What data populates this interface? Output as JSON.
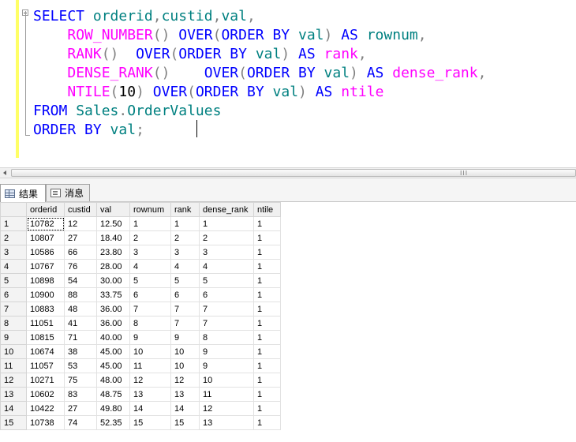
{
  "editor": {
    "lines": [
      [
        {
          "t": "SELECT ",
          "c": "kw"
        },
        {
          "t": "orderid",
          "c": "id"
        },
        {
          "t": ",",
          "c": "op"
        },
        {
          "t": "custid",
          "c": "id"
        },
        {
          "t": ",",
          "c": "op"
        },
        {
          "t": "val",
          "c": "id"
        },
        {
          "t": ",",
          "c": "op"
        }
      ],
      [
        {
          "t": "    ",
          "c": "tx"
        },
        {
          "t": "ROW_NUMBER",
          "c": "fn"
        },
        {
          "t": "() ",
          "c": "op"
        },
        {
          "t": "OVER",
          "c": "kw"
        },
        {
          "t": "(",
          "c": "op"
        },
        {
          "t": "ORDER BY ",
          "c": "kw"
        },
        {
          "t": "val",
          "c": "id"
        },
        {
          "t": ") ",
          "c": "op"
        },
        {
          "t": "AS ",
          "c": "kw"
        },
        {
          "t": "rownum",
          "c": "id"
        },
        {
          "t": ",",
          "c": "op"
        }
      ],
      [
        {
          "t": "    ",
          "c": "tx"
        },
        {
          "t": "RANK",
          "c": "fn"
        },
        {
          "t": "()  ",
          "c": "op"
        },
        {
          "t": "OVER",
          "c": "kw"
        },
        {
          "t": "(",
          "c": "op"
        },
        {
          "t": "ORDER BY ",
          "c": "kw"
        },
        {
          "t": "val",
          "c": "id"
        },
        {
          "t": ") ",
          "c": "op"
        },
        {
          "t": "AS ",
          "c": "kw"
        },
        {
          "t": "rank",
          "c": "fn"
        },
        {
          "t": ",",
          "c": "op"
        }
      ],
      [
        {
          "t": "    ",
          "c": "tx"
        },
        {
          "t": "DENSE_RANK",
          "c": "fn"
        },
        {
          "t": "()    ",
          "c": "op"
        },
        {
          "t": "OVER",
          "c": "kw"
        },
        {
          "t": "(",
          "c": "op"
        },
        {
          "t": "ORDER BY ",
          "c": "kw"
        },
        {
          "t": "val",
          "c": "id"
        },
        {
          "t": ") ",
          "c": "op"
        },
        {
          "t": "AS ",
          "c": "kw"
        },
        {
          "t": "dense_rank",
          "c": "fn"
        },
        {
          "t": ",",
          "c": "op"
        }
      ],
      [
        {
          "t": "    ",
          "c": "tx"
        },
        {
          "t": "NTILE",
          "c": "fn"
        },
        {
          "t": "(",
          "c": "op"
        },
        {
          "t": "10",
          "c": "tx"
        },
        {
          "t": ") ",
          "c": "op"
        },
        {
          "t": "OVER",
          "c": "kw"
        },
        {
          "t": "(",
          "c": "op"
        },
        {
          "t": "ORDER BY ",
          "c": "kw"
        },
        {
          "t": "val",
          "c": "id"
        },
        {
          "t": ") ",
          "c": "op"
        },
        {
          "t": "AS ",
          "c": "kw"
        },
        {
          "t": "ntile",
          "c": "fn"
        }
      ],
      [
        {
          "t": "FROM ",
          "c": "kw"
        },
        {
          "t": "Sales",
          "c": "id"
        },
        {
          "t": ".",
          "c": "op"
        },
        {
          "t": "OrderValues",
          "c": "id"
        }
      ],
      [
        {
          "t": "ORDER BY ",
          "c": "kw"
        },
        {
          "t": "val",
          "c": "id"
        },
        {
          "t": ";",
          "c": "op"
        }
      ]
    ]
  },
  "scrollbar": {
    "grip": "III"
  },
  "tabs": {
    "results": "结果",
    "messages": "消息"
  },
  "grid": {
    "columns": [
      "orderid",
      "custid",
      "val",
      "rownum",
      "rank",
      "dense_rank",
      "ntile"
    ],
    "rows": [
      [
        "1",
        "10782",
        "12",
        "12.50",
        "1",
        "1",
        "1",
        "1"
      ],
      [
        "2",
        "10807",
        "27",
        "18.40",
        "2",
        "2",
        "2",
        "1"
      ],
      [
        "3",
        "10586",
        "66",
        "23.80",
        "3",
        "3",
        "3",
        "1"
      ],
      [
        "4",
        "10767",
        "76",
        "28.00",
        "4",
        "4",
        "4",
        "1"
      ],
      [
        "5",
        "10898",
        "54",
        "30.00",
        "5",
        "5",
        "5",
        "1"
      ],
      [
        "6",
        "10900",
        "88",
        "33.75",
        "6",
        "6",
        "6",
        "1"
      ],
      [
        "7",
        "10883",
        "48",
        "36.00",
        "7",
        "7",
        "7",
        "1"
      ],
      [
        "8",
        "11051",
        "41",
        "36.00",
        "8",
        "7",
        "7",
        "1"
      ],
      [
        "9",
        "10815",
        "71",
        "40.00",
        "9",
        "9",
        "8",
        "1"
      ],
      [
        "10",
        "10674",
        "38",
        "45.00",
        "10",
        "10",
        "9",
        "1"
      ],
      [
        "11",
        "11057",
        "53",
        "45.00",
        "11",
        "10",
        "9",
        "1"
      ],
      [
        "12",
        "10271",
        "75",
        "48.00",
        "12",
        "12",
        "10",
        "1"
      ],
      [
        "13",
        "10602",
        "83",
        "48.75",
        "13",
        "13",
        "11",
        "1"
      ],
      [
        "14",
        "10422",
        "27",
        "49.80",
        "14",
        "14",
        "12",
        "1"
      ],
      [
        "15",
        "10738",
        "74",
        "52.35",
        "15",
        "15",
        "13",
        "1"
      ]
    ]
  }
}
